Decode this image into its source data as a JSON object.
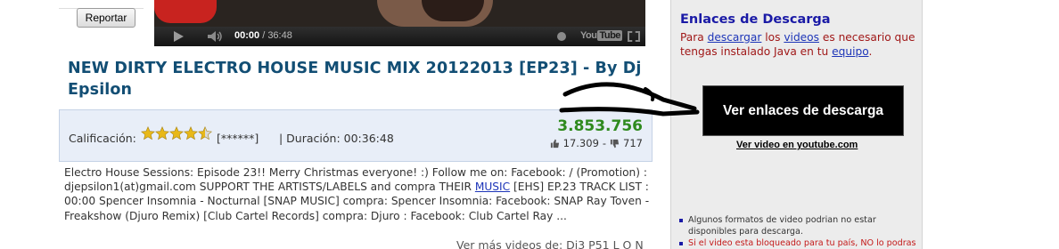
{
  "report_button": "Reportar",
  "player": {
    "time_current": "00:00",
    "time_sep": " / ",
    "time_total": "36:48",
    "brand": "You",
    "brand_tube": "Tube"
  },
  "video": {
    "title": "NEW DIRTY ELECTRO HOUSE MUSIC MIX 20122013 [EP23] - By Dj Epsilon",
    "rating_label": "Calificación:",
    "rating_value_text": "[******]",
    "rating_stars": 4.5,
    "duration_text": "| Duración: 00:36:48",
    "views": "3.853.756",
    "likes": "17.309",
    "separator": "-",
    "dislikes": "717"
  },
  "description": {
    "text_before_link": "Electro House Sessions: Episode 23!! Merry Christmas everyone! :) Follow me on: Facebook: / (Promotion) : djepsilon1(at)gmail.com SUPPORT THE ARTISTS/LABELS and compra THEIR ",
    "link_text": "MUSIC",
    "text_after_link": " [EHS] EP.23 TRACK LIST : 00:00 Spencer Insomnia - Nocturnal [SNAP MUSIC] compra: Spencer Insomnia: Facebook: SNAP Ray Toven - Freakshow (Djuro Remix) [Club Cartel Records] compra: Djuro : Facebook: Club Cartel Ray ...",
    "more_prefix": "Ver más ",
    "more_link": "videos",
    "more_suffix": " de: Dj3 P51 L O N"
  },
  "sidebar": {
    "heading": "Enlaces de Descarga",
    "note_part1": "Para ",
    "note_link1": "descargar",
    "note_part2": " los ",
    "note_link2": "videos",
    "note_part3": " es necesario que tengas instalado Java en tu ",
    "note_link3": "equipo",
    "note_part4": ".",
    "download_button": "Ver enlaces de descarga",
    "youtube_link": "Ver video en youtube.com",
    "notes": [
      "Algunos formatos de video podrian no estar disponibles para descarga.",
      "Si el video esta bloqueado para tu país, NO lo podras"
    ]
  },
  "colors": {
    "title": "#124e74",
    "views": "#2f8a1e",
    "heading": "#1a1aa6",
    "note_red": "#a01818",
    "button_bg": "#000000"
  }
}
